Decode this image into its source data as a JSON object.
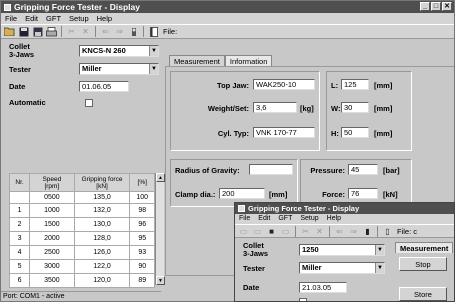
{
  "main": {
    "title": "Gripping Force Tester - Display",
    "title_buttons": [
      "_",
      "□",
      "✕"
    ],
    "menu": [
      "File",
      "Edit",
      "GFT",
      "Setup",
      "Help"
    ],
    "file_label": "File:",
    "collet_label": "Collet\n3-Jaws",
    "collet_value": "KNCS-N 260",
    "tester_label": "Tester",
    "tester_value": "Miller",
    "date_label": "Date",
    "date_value": "01.06.05",
    "automatic_label": "Automatic",
    "tabs": [
      "Measurement",
      "Information"
    ],
    "top_jaw_label": "Top Jaw:",
    "top_jaw_value": "WAK250-10",
    "weight_label": "Weight/Set:",
    "weight_value": "3,6",
    "weight_unit": "[kg]",
    "cyl_label": "Cyl. Typ:",
    "cyl_value": "VNK 170-77",
    "L_label": "L:",
    "L_value": "125",
    "L_unit": "[mm]",
    "W_label": "W:",
    "W_value": "30",
    "W_unit": "[mm]",
    "H_label": "H:",
    "H_value": "50",
    "H_unit": "[mm]",
    "radius_label": "Radius of Gravity:",
    "radius_value": "",
    "clamp_label": "Clamp dia.:",
    "clamp_value": "200",
    "clamp_unit": "[mm]",
    "pressure_label": "Pressure:",
    "pressure_value": "45",
    "pressure_unit": "[bar]",
    "force_label": "Force:",
    "force_value": "76",
    "force_unit": "[kN]",
    "table": {
      "headers": [
        "Nr.",
        "Speed\n[rpm]",
        "Gripping force\n[kN]",
        "[%]"
      ],
      "rows": [
        [
          "",
          "0500",
          "135,0",
          "100"
        ],
        [
          "1",
          "1000",
          "132,0",
          "98"
        ],
        [
          "2",
          "1500",
          "130,0",
          "96"
        ],
        [
          "3",
          "2000",
          "128,0",
          "95"
        ],
        [
          "4",
          "2500",
          "126,0",
          "93"
        ],
        [
          "5",
          "3000",
          "122,0",
          "90"
        ],
        [
          "6",
          "3500",
          "120,0",
          "89"
        ]
      ]
    },
    "status": "Port: COM1 - active"
  },
  "sub": {
    "title": "Gripping Force Tester - Display",
    "menu": [
      "File",
      "Edit",
      "GFT",
      "Setup",
      "Help"
    ],
    "file_label": "File: c",
    "collet_label": "Collet\n3-Jaws",
    "collet_value": "1250",
    "tester_label": "Tester",
    "tester_value": "Miller",
    "date_label": "Date",
    "date_value": "21.03.05",
    "tab": "Measurement",
    "stop_label": "Stop",
    "store_label": "Store"
  }
}
